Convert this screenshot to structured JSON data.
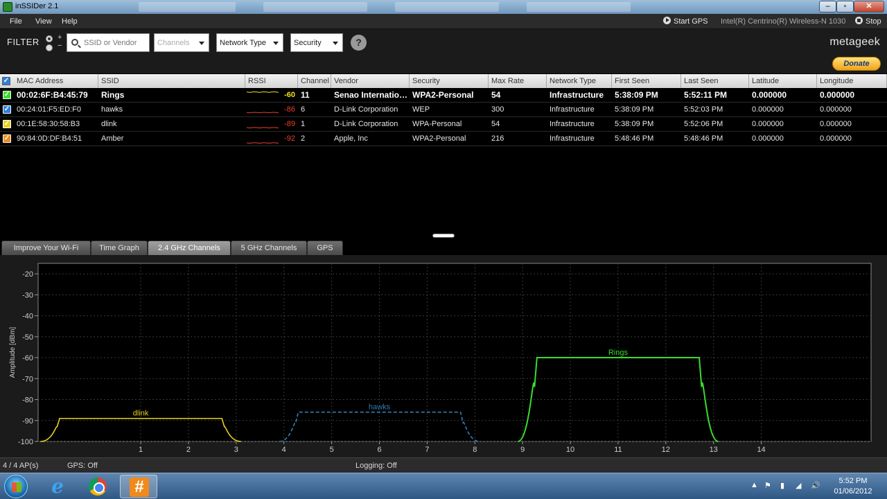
{
  "window": {
    "title": "inSSIDer 2.1"
  },
  "menu": {
    "items": [
      "File",
      "View",
      "Help"
    ],
    "start_gps": "Start GPS",
    "adapter": "Intel(R) Centrino(R) Wireless-N 1030",
    "stop": "Stop"
  },
  "filter": {
    "label": "FILTER",
    "plus": "+",
    "minus": "−",
    "search_placeholder": "SSID or Vendor",
    "channels": "Channels",
    "network_type": "Network Type",
    "security": "Security",
    "help": "?"
  },
  "brand": {
    "logo": "metageek",
    "donate": "Donate"
  },
  "table": {
    "headers": [
      "MAC Address",
      "SSID",
      "RSSI",
      "Channel",
      "Vendor",
      "Security",
      "Max Rate",
      "Network Type",
      "First Seen",
      "Last Seen",
      "Latitude",
      "Longitude"
    ],
    "rows": [
      {
        "mac": "00:02:6F:B4:45:79",
        "ssid": "Rings",
        "rssi": "-60",
        "channel": "11",
        "vendor": "Senao International Co., Ltd.",
        "security": "WPA2-Personal",
        "max_rate": "54",
        "network_type": "Infrastructure",
        "first_seen": "5:38:09 PM",
        "last_seen": "5:52:11 PM",
        "latitude": "0.000000",
        "longitude": "0.000000",
        "color": "#3adc2c",
        "rssi_color": "#f0e020"
      },
      {
        "mac": "00:24:01:F5:ED:F0",
        "ssid": "hawks",
        "rssi": "-86",
        "channel": "6",
        "vendor": "D-Link Corporation",
        "security": "WEP",
        "max_rate": "300",
        "network_type": "Infrastructure",
        "first_seen": "5:38:09 PM",
        "last_seen": "5:52:03 PM",
        "latitude": "0.000000",
        "longitude": "0.000000",
        "color": "#2f7fe0",
        "rssi_color": "#e8402a"
      },
      {
        "mac": "00:1E:58:30:58:B3",
        "ssid": "dlink",
        "rssi": "-89",
        "channel": "1",
        "vendor": "D-Link Corporation",
        "security": "WPA-Personal",
        "max_rate": "54",
        "network_type": "Infrastructure",
        "first_seen": "5:38:09 PM",
        "last_seen": "5:52:06 PM",
        "latitude": "0.000000",
        "longitude": "0.000000",
        "color": "#e6d020",
        "rssi_color": "#e8402a"
      },
      {
        "mac": "90:84:0D:DF:B4:51",
        "ssid": "Amber",
        "rssi": "-92",
        "channel": "2",
        "vendor": "Apple, Inc",
        "security": "WPA2-Personal",
        "max_rate": "216",
        "network_type": "Infrastructure",
        "first_seen": "5:48:46 PM",
        "last_seen": "5:48:46 PM",
        "latitude": "0.000000",
        "longitude": "0.000000",
        "color": "#f08a1c",
        "rssi_color": "#e8402a"
      }
    ]
  },
  "tabs": [
    {
      "label": "Improve Your Wi-Fi",
      "active": false
    },
    {
      "label": "Time Graph",
      "active": false
    },
    {
      "label": "2.4 GHz Channels",
      "active": true
    },
    {
      "label": "5 GHz Channels",
      "active": false
    },
    {
      "label": "GPS",
      "active": false
    }
  ],
  "chart_data": {
    "type": "area",
    "ylabel": "Amplitude [dBm]",
    "xlabel": "",
    "ylim": [
      -100,
      -15
    ],
    "xlim": [
      -1.15,
      16.3
    ],
    "y_ticks": [
      -20,
      -30,
      -40,
      -50,
      -60,
      -70,
      -80,
      -90,
      -100
    ],
    "x_ticks": [
      1,
      2,
      3,
      4,
      5,
      6,
      7,
      8,
      9,
      10,
      11,
      12,
      13,
      14
    ],
    "grid": true,
    "series": [
      {
        "name": "dlink",
        "channel": 1,
        "values": [
          {
            "x": -1,
            "y": -100
          },
          {
            "x": -0.6,
            "y": -98
          },
          {
            "x": -0.8,
            "y": -95
          }
        ],
        "peak": -89,
        "color": "#e6d020",
        "dashed": false
      },
      {
        "name": "hawks",
        "channel": 6,
        "peak": -86,
        "color": "#2f7fb8",
        "dashed": true
      },
      {
        "name": "Rings",
        "channel": 11,
        "peak": -60,
        "color": "#3adc2c",
        "dashed": false
      }
    ]
  },
  "status": {
    "ap_count": "4 / 4 AP(s)",
    "gps": "GPS: Off",
    "logging": "Logging: Off"
  },
  "taskbar": {
    "time": "5:52 PM",
    "date": "01/06/2012"
  }
}
